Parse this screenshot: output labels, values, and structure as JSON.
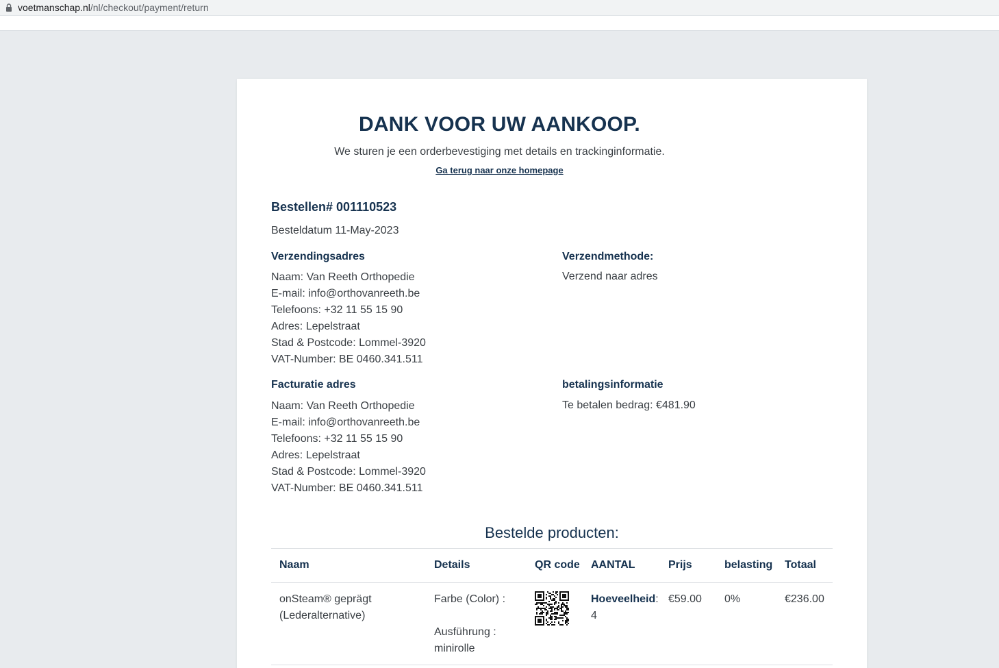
{
  "browser": {
    "url_domain": "voetmanschap.nl",
    "url_path": "/nl/checkout/payment/return"
  },
  "confirmation": {
    "title": "DANK VOOR UW AANKOOP.",
    "subtitle": "We sturen je een orderbevestiging met details en trackinginformatie.",
    "home_link": "Ga terug naar onze homepage"
  },
  "order": {
    "number": "Bestellen# 001110523",
    "date": "Besteldatum 11-May-2023"
  },
  "shipping_address": {
    "heading": "Verzendingsadres",
    "lines": [
      "Naam: Van Reeth Orthopedie",
      "E-mail: info@orthovanreeth.be",
      "Telefoons: +32 11 55 15 90",
      "Adres: Lepelstraat",
      "Stad & Postcode: Lommel-3920",
      "VAT-Number: BE 0460.341.511"
    ]
  },
  "shipping_method": {
    "heading": "Verzendmethode:",
    "value": "Verzend naar adres"
  },
  "billing_address": {
    "heading": "Facturatie adres",
    "lines": [
      "Naam: Van Reeth Orthopedie",
      "E-mail: info@orthovanreeth.be",
      "Telefoons: +32 11 55 15 90",
      "Adres: Lepelstraat",
      "Stad & Postcode: Lommel-3920",
      "VAT-Number: BE 0460.341.511"
    ]
  },
  "payment": {
    "heading": "betalingsinformatie",
    "value": "Te betalen bedrag: €481.90"
  },
  "products": {
    "heading": "Bestelde producten:",
    "columns": [
      "Naam",
      "Details",
      "QR code",
      "AANTAL",
      "Prijs",
      "belasting",
      "Totaal"
    ],
    "rows": [
      {
        "name_line1": "onSteam® geprägt",
        "name_line2": "(Lederalternative)",
        "detail1": "Farbe (Color) :",
        "detail2_label": "Ausführung :",
        "detail2_value": "minirolle",
        "qty_label": "Hoeveelheid",
        "qty_colon": ":",
        "qty_value": "4",
        "price": "€59.00",
        "tax": "0%",
        "total": "€236.00"
      }
    ]
  },
  "colors": {
    "page_bg": "#e8ebee",
    "card_bg": "#ffffff",
    "heading": "#16324f",
    "text": "#3a3f44"
  },
  "icons": [
    "lock-icon",
    "qr-code-icon"
  ]
}
